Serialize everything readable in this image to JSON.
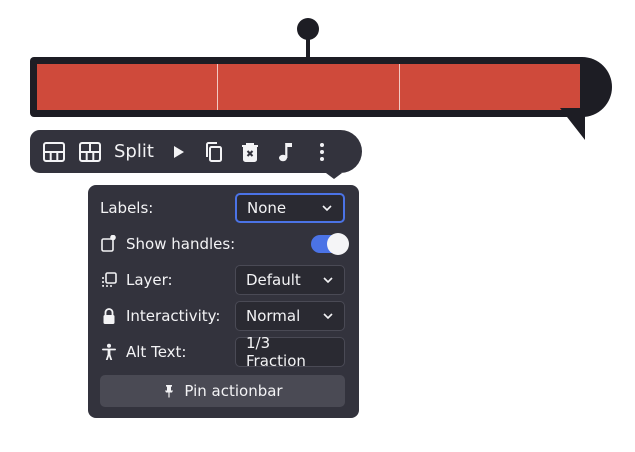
{
  "actionbar": {
    "split_label": "Split"
  },
  "settings": {
    "labels": {
      "label": "Labels:",
      "value": "None"
    },
    "show_handles": {
      "label": "Show handles:",
      "enabled": true
    },
    "layer": {
      "label": "Layer:",
      "value": "Default"
    },
    "interactivity": {
      "label": "Interactivity:",
      "value": "Normal"
    },
    "alt_text": {
      "label": "Alt Text:",
      "value": "1/3 Fraction"
    },
    "pin_label": "Pin actionbar"
  },
  "fraction_bar": {
    "parts": 3
  },
  "colors": {
    "accent": "#4b73e6",
    "bar_fill": "#cf4a3b",
    "panel_bg": "#33333d",
    "outline": "#1d1d24"
  }
}
